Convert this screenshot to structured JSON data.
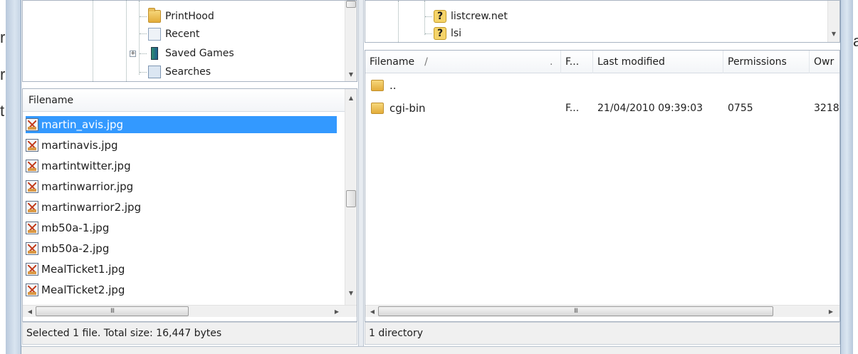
{
  "background_text": [
    "r",
    "r",
    "t",
    "a"
  ],
  "left_tree": {
    "items": [
      {
        "label": "PrintHood",
        "icon": "folder-icon"
      },
      {
        "label": "Recent",
        "icon": "recent-icon"
      },
      {
        "label": "Saved Games",
        "icon": "saved-games-icon"
      },
      {
        "label": "Searches",
        "icon": "searches-icon"
      }
    ]
  },
  "right_tree": {
    "items": [
      {
        "label": "listcrew.net",
        "icon": "unknown-folder-icon"
      },
      {
        "label": "lsi",
        "icon": "unknown-folder-icon"
      }
    ]
  },
  "local_list": {
    "header": "Filename",
    "files": [
      "martin_avis.jpg",
      "martinavis.jpg",
      "martintwitter.jpg",
      "martinwarrior.jpg",
      "martinwarrior2.jpg",
      "mb50a-1.jpg",
      "mb50a-2.jpg",
      "MealTicket1.jpg",
      "MealTicket2.jpg"
    ],
    "selected_index": 0,
    "hscroll_grip": "III",
    "status": "Selected 1 file. Total size: 16,447 bytes"
  },
  "remote_list": {
    "columns": {
      "filename": "Filename",
      "sort_indicator": "/",
      "dot": ".",
      "filetype": "F...",
      "last_modified": "Last modified",
      "permissions": "Permissions",
      "owner": "Owr"
    },
    "rows": [
      {
        "name": "..",
        "type": "",
        "modified": "",
        "permissions": "",
        "owner": ""
      },
      {
        "name": "cgi-bin",
        "type": "F...",
        "modified": "21/04/2010 09:39:03",
        "permissions": "0755",
        "owner": "3218"
      }
    ],
    "hscroll_grip": "III",
    "status": "1 directory"
  },
  "colors": {
    "selection": "#3399ff",
    "folder": "#e3ac3a"
  }
}
